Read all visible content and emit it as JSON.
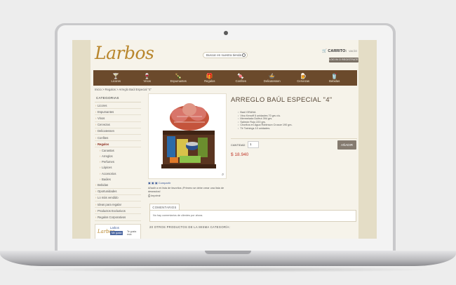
{
  "site": {
    "logo": "Larbos",
    "search_placeholder": "Buscar en nuestra tienda",
    "cart_label": "CARRITO:",
    "cart_value": "VACÍO",
    "login_label": "LOG IN O REGISTRATE"
  },
  "nav": [
    {
      "label": "Licores",
      "icon": "cocktail-glass-icon",
      "glyph": "🍸"
    },
    {
      "label": "Vinos",
      "icon": "wine-glass-icon",
      "glyph": "🍷"
    },
    {
      "label": "Espumantes",
      "icon": "bottle-icon",
      "glyph": "🍾"
    },
    {
      "label": "Regalos",
      "icon": "gift-icon",
      "glyph": "🎁"
    },
    {
      "label": "Confites",
      "icon": "candy-icon",
      "glyph": "🍬"
    },
    {
      "label": "Delicatessen",
      "icon": "chef-hat-icon",
      "glyph": "🍲"
    },
    {
      "label": "Cervezas",
      "icon": "beer-icon",
      "glyph": "🍺"
    },
    {
      "label": "Bebidas",
      "icon": "drink-icon",
      "glyph": "🥤"
    }
  ],
  "breadcrumb": "Inicio  >  Regalos  >  Arreglo Baúl Especial \"4\"",
  "sidebar": {
    "title": "CATEGORIAS",
    "items": [
      {
        "label": "Licores",
        "type": "item"
      },
      {
        "label": "Espumantes",
        "type": "item"
      },
      {
        "label": "Vinos",
        "type": "item"
      },
      {
        "label": "Cervezas",
        "type": "item"
      },
      {
        "label": "Delicatessen",
        "type": "item"
      },
      {
        "label": "Confites",
        "type": "item"
      },
      {
        "label": "Regalos",
        "type": "active"
      },
      {
        "label": "Canastas",
        "type": "sub"
      },
      {
        "label": "Arreglos",
        "type": "sub"
      },
      {
        "label": "Perfumes",
        "type": "sub"
      },
      {
        "label": "Lápices",
        "type": "sub"
      },
      {
        "label": "Accesorios",
        "type": "sub"
      },
      {
        "label": "Baúles",
        "type": "sub"
      },
      {
        "label": "Bebidas",
        "type": "item"
      },
      {
        "label": "Oportunidades",
        "type": "item"
      },
      {
        "label": "Lo más vendido",
        "type": "item"
      },
      {
        "label": "Ideas para regalar",
        "type": "item"
      },
      {
        "label": "Productos Exclusivos",
        "type": "item"
      },
      {
        "label": "Regalos Corporativos",
        "type": "item"
      }
    ],
    "fb_logo": "Larbos",
    "fb_name": "Larbos",
    "fb_like": "Me gusta",
    "fb_count": "Te gusta esto"
  },
  "product": {
    "title": "ARREGLO BAÚL ESPECIAL \"4\"",
    "contents": [
      "Baúl GRANA",
      "Vino Kenoff 5 unidades 70 grs c/u.",
      "Mermelada Dulfrut 394 grs.",
      "Salmón Rojo 220 grs.",
      "Choritos en Agua Robinson Crusoe 190 grs.",
      "Té Twinings 10 unidades."
    ],
    "qty_label": "CANTIDAD",
    "qty_value": "1",
    "price": "$ 18.940",
    "add_button": "AÑADIR",
    "share_label": "Compartir",
    "wishlist_text": "Añadir a mi lista de favoritos  ¡Primero se debe crear una lista de deseados!",
    "print_label": "Imprimir"
  },
  "comments": {
    "tab_label": "COMENTARIOS",
    "empty_text": "No hay comentarios de clientes por ahora."
  },
  "related_title": "20 OTROS PRODUCTOS DE LA MISMA CATEGORÍA:"
}
